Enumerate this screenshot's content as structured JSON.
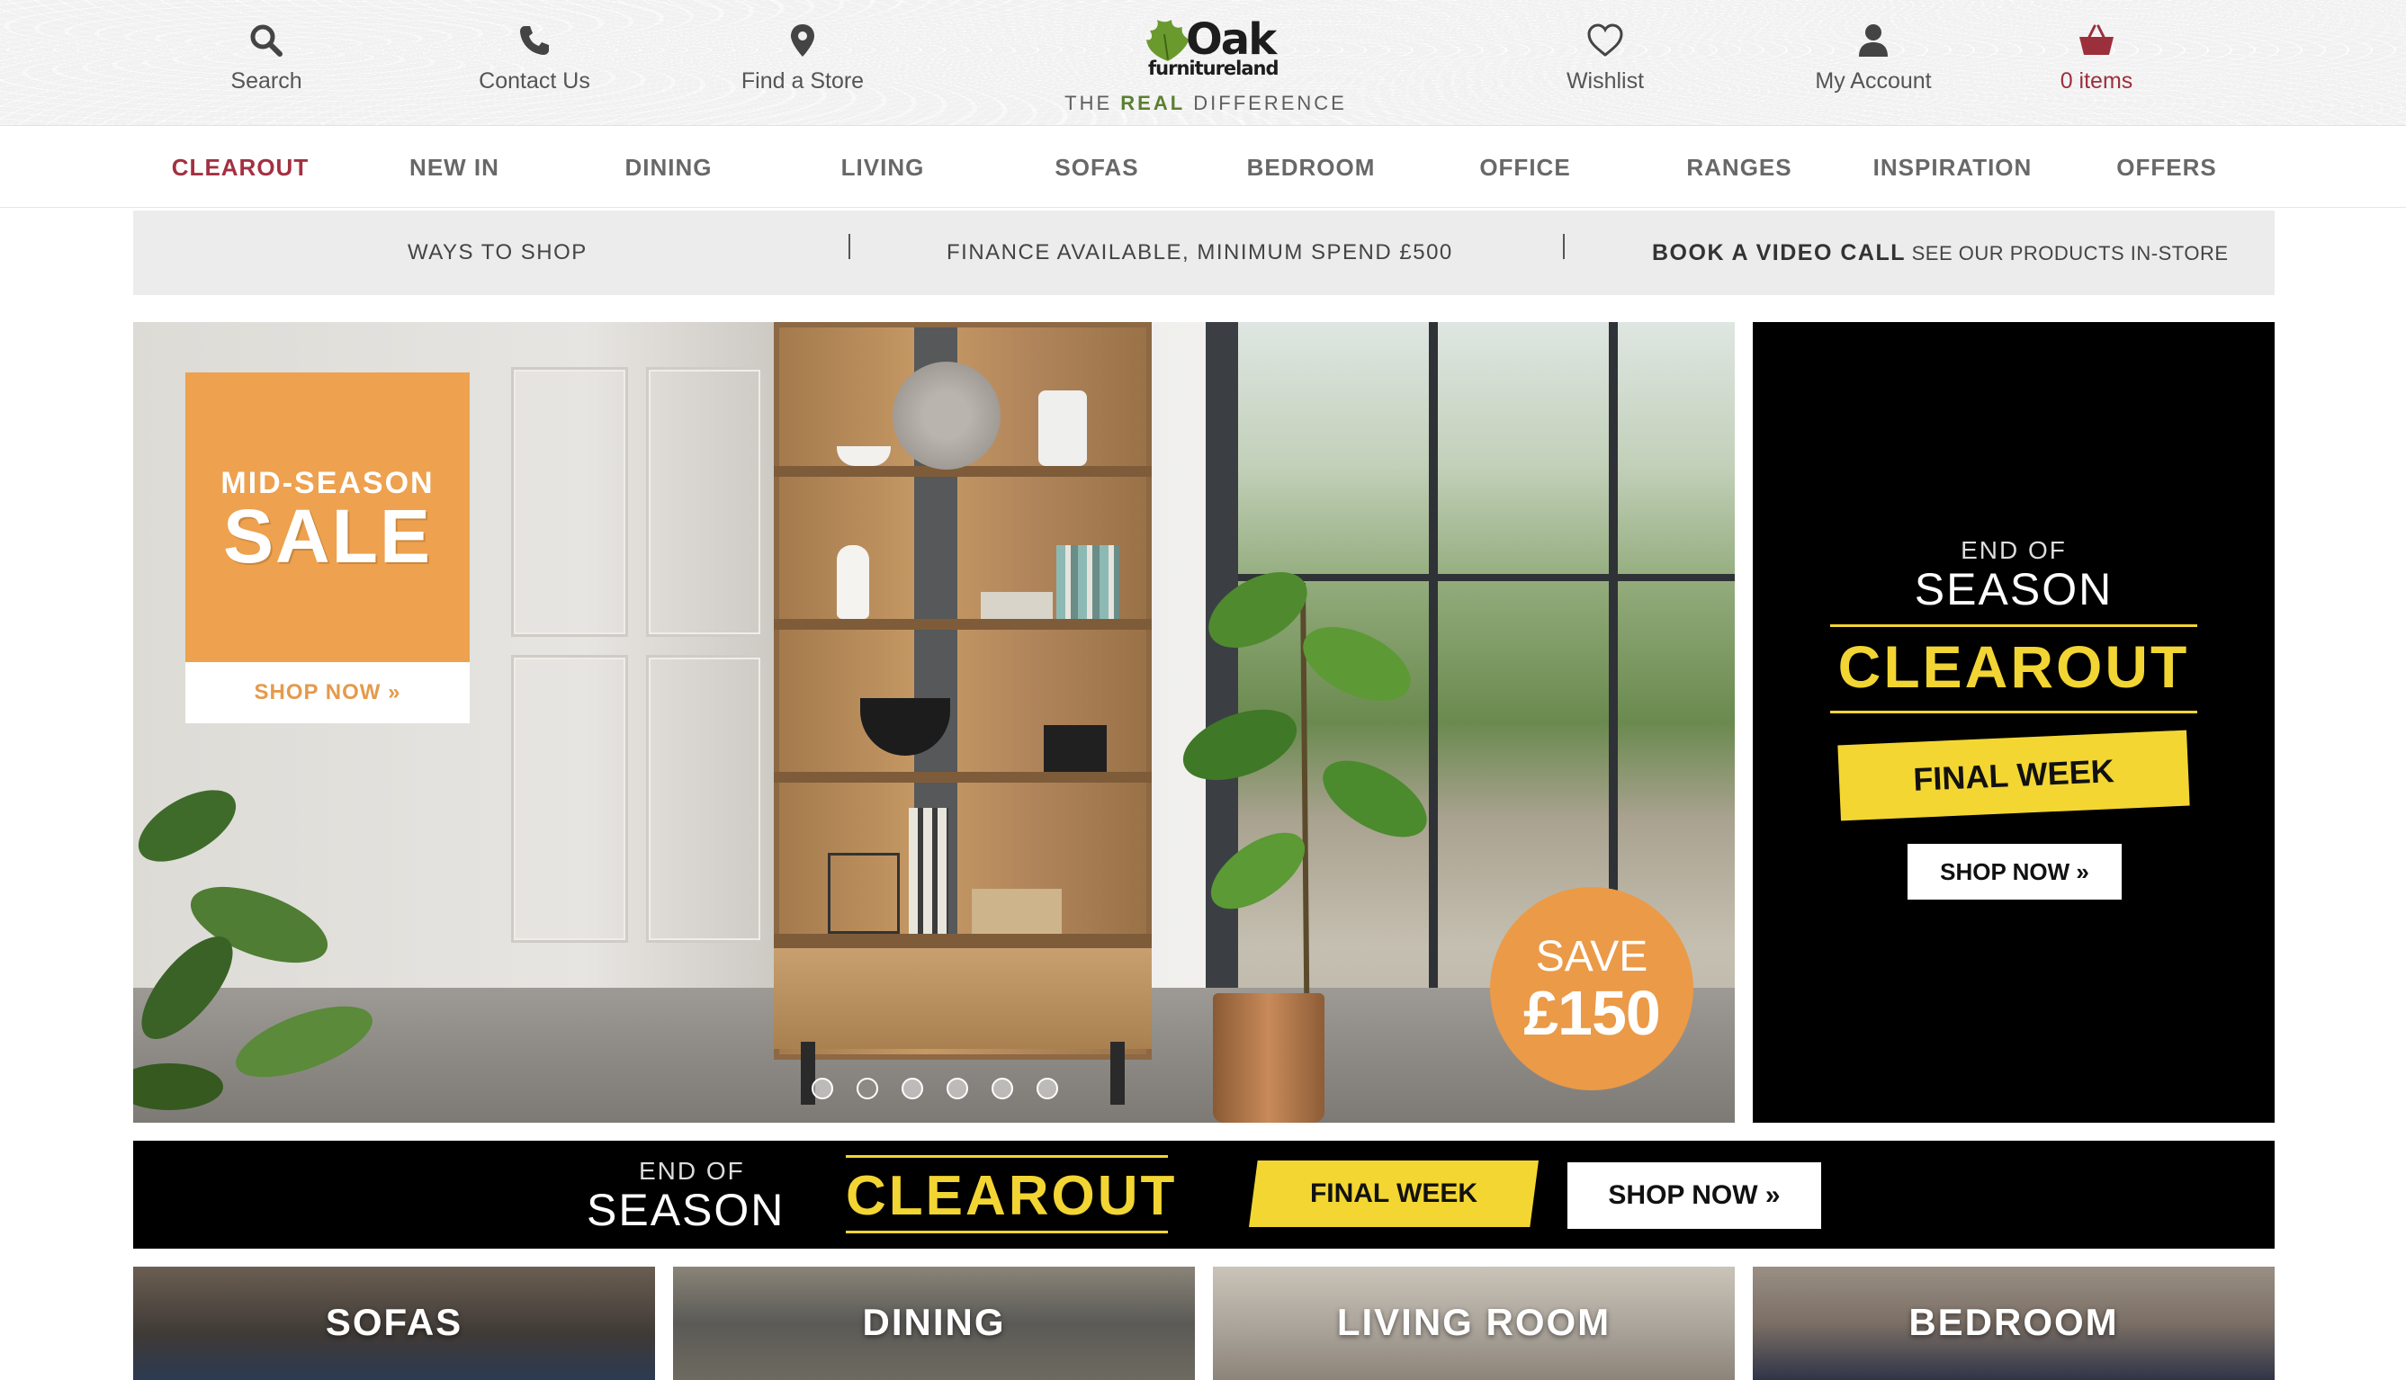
{
  "header": {
    "tools": [
      {
        "label": "Search",
        "icon": "search-icon"
      },
      {
        "label": "Contact Us",
        "icon": "phone-icon"
      },
      {
        "label": "Find a Store",
        "icon": "location-pin-icon"
      },
      {
        "label": "Wishlist",
        "icon": "heart-icon"
      },
      {
        "label": "My Account",
        "icon": "user-icon"
      },
      {
        "label": "0 items",
        "icon": "basket-icon"
      }
    ],
    "logo": {
      "word": "Oak",
      "sub": "furnitureland",
      "tagline_pre": "THE ",
      "tagline_bold": "REAL",
      "tagline_post": " DIFFERENCE"
    }
  },
  "nav": {
    "items": [
      "CLEAROUT",
      "NEW IN",
      "DINING",
      "LIVING",
      "SOFAS",
      "BEDROOM",
      "OFFICE",
      "RANGES",
      "INSPIRATION",
      "OFFERS"
    ],
    "active_index": 0
  },
  "strip": {
    "ways": "WAYS TO SHOP",
    "finance": "FINANCE AVAILABLE, MINIMUM SPEND £500",
    "video_bold": "BOOK A VIDEO CALL",
    "video_rest": " SEE OUR PRODUCTS IN-STORE"
  },
  "hero": {
    "sale_line1": "MID-SEASON",
    "sale_line2": "SALE",
    "sale_cta": "SHOP NOW »",
    "badge_line1": "SAVE",
    "badge_line2": "£150",
    "slide_count": 6,
    "active_slide": 1
  },
  "side_promo": {
    "line1": "END OF",
    "line2": "SEASON",
    "line3": "CLEAROUT",
    "ribbon": "FINAL WEEK",
    "cta": "SHOP NOW »"
  },
  "banner": {
    "line1": "END OF",
    "line2": "SEASON",
    "line3": "CLEAROUT",
    "ribbon": "FINAL WEEK",
    "cta": "SHOP NOW »"
  },
  "categories": [
    "SOFAS",
    "DINING",
    "LIVING ROOM",
    "BEDROOM"
  ],
  "colors": {
    "accent": "#a33041",
    "promo_yellow": "#f2d533",
    "sale_orange": "#eea14e",
    "logo_green": "#5a7f2f"
  }
}
